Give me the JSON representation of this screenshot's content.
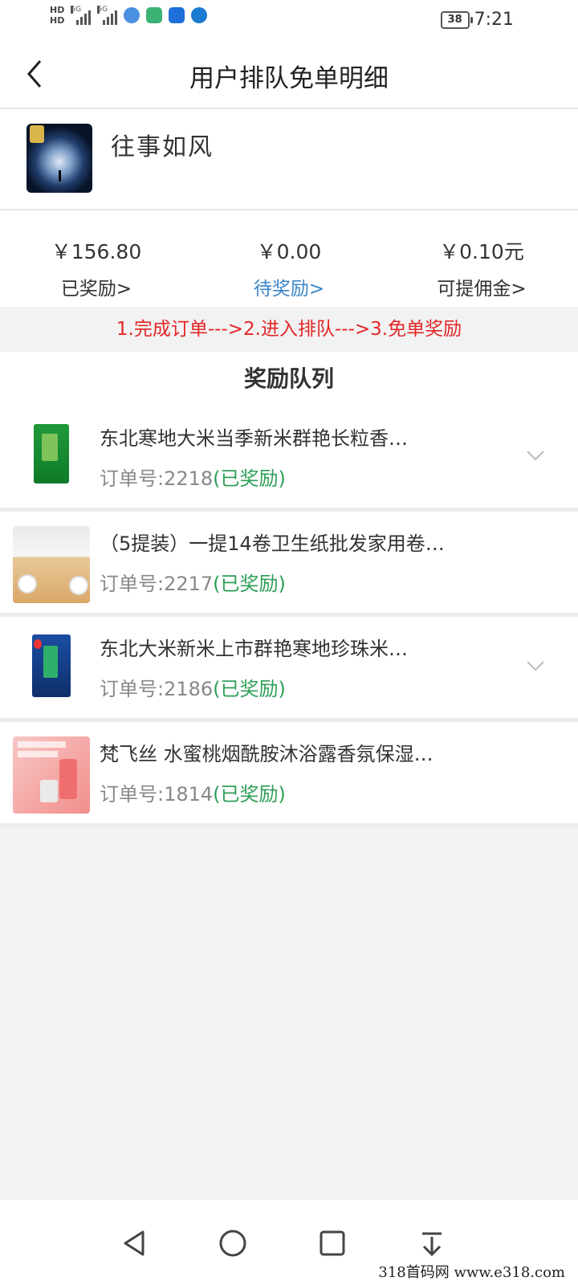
{
  "statusbar": {
    "network_label": "5G",
    "battery_level": "38",
    "time": "7:21"
  },
  "header": {
    "title": "用户排队免单明细"
  },
  "profile": {
    "nickname": "往事如风"
  },
  "stats": [
    {
      "amount": "￥156.80",
      "label": "已奖励>"
    },
    {
      "amount": "￥0.00",
      "label": "待奖励>"
    },
    {
      "amount": "￥0.10元",
      "label": "可提佣金>"
    }
  ],
  "steps_text": "1.完成订单--->2.进入排队--->3.免单奖励",
  "queue": {
    "title": "奖励队列",
    "items": [
      {
        "name": "东北寒地大米当季新米群艳长粒香…",
        "order_prefix": "订单号:2218",
        "status": "(已奖励)"
      },
      {
        "name": "（5提装）一提14卷卫生纸批发家用卷…",
        "order_prefix": "订单号:2217",
        "status": "(已奖励)"
      },
      {
        "name": "东北大米新米上市群艳寒地珍珠米…",
        "order_prefix": "订单号:2186",
        "status": "(已奖励)"
      },
      {
        "name": "梵飞丝 水蜜桃烟酰胺沐浴露香氛保湿…",
        "order_prefix": "订单号:1814",
        "status": "(已奖励)"
      }
    ]
  },
  "watermark": "318首码网  www.e318.com",
  "colors": {
    "accent_blue": "#3a86c8",
    "steps_red": "#e32626",
    "status_green": "#2e9e57"
  }
}
